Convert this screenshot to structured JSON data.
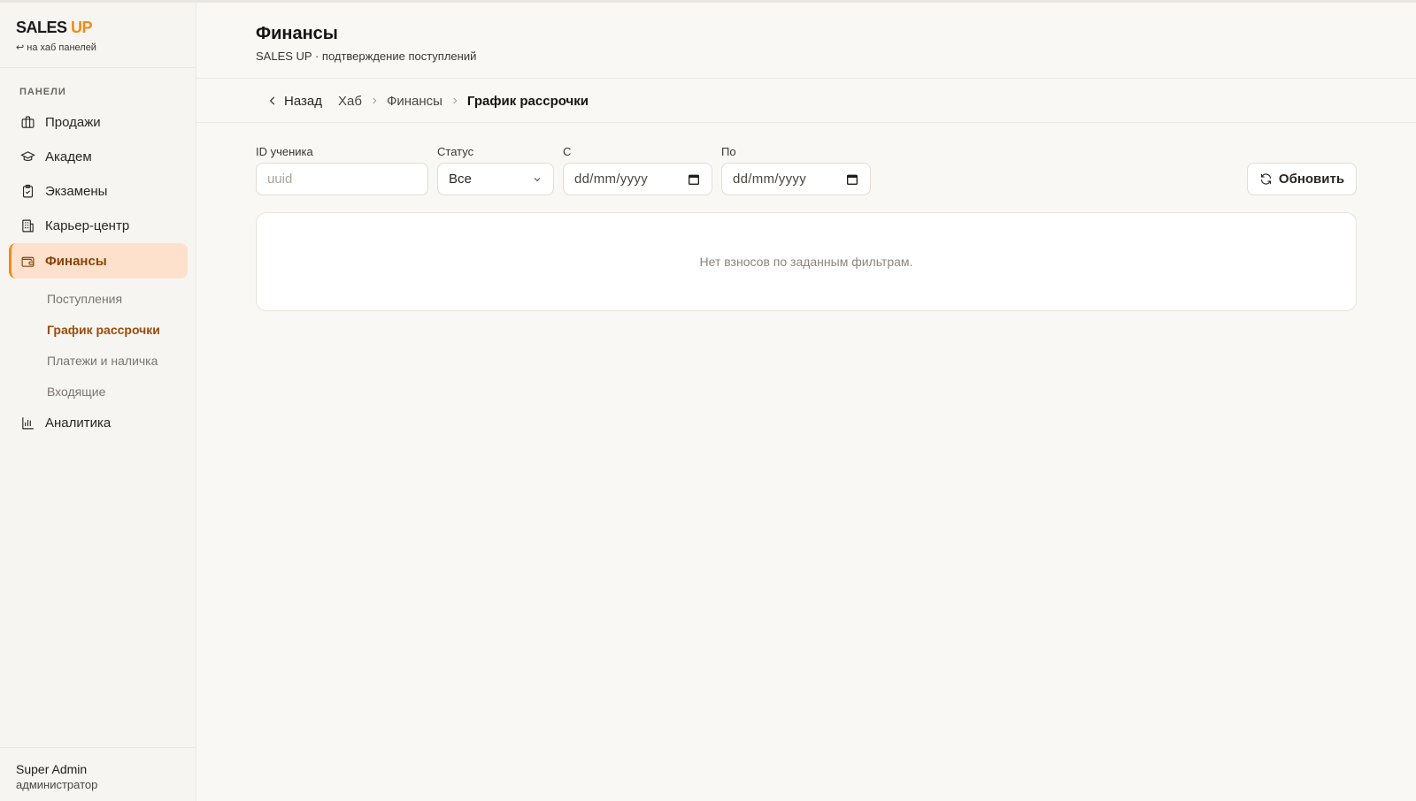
{
  "brand": {
    "name_main": "SALES",
    "name_accent": "UP",
    "hub_link": "↩ на хаб панелей"
  },
  "sidebar": {
    "section_label": "ПАНЕЛИ",
    "items": [
      {
        "label": "Продажи",
        "icon": "briefcase-icon"
      },
      {
        "label": "Академ",
        "icon": "graduation-cap-icon"
      },
      {
        "label": "Экзамены",
        "icon": "clipboard-check-icon"
      },
      {
        "label": "Карьер-центр",
        "icon": "building-icon"
      },
      {
        "label": "Финансы",
        "icon": "wallet-icon",
        "active": true
      },
      {
        "label": "Аналитика",
        "icon": "bar-chart-icon"
      }
    ],
    "sub_items": [
      {
        "label": "Поступления"
      },
      {
        "label": "График рассрочки",
        "active": true
      },
      {
        "label": "Платежи и наличка"
      },
      {
        "label": "Входящие"
      }
    ]
  },
  "user": {
    "name": "Super Admin",
    "role": "администратор"
  },
  "header": {
    "title": "Финансы",
    "subtitle": "SALES UP · подтверждение поступлений"
  },
  "breadcrumb": {
    "back": "Назад",
    "items": [
      "Хаб",
      "Финансы"
    ],
    "current": "График рассрочки"
  },
  "filters": {
    "student_id": {
      "label": "ID ученика",
      "placeholder": "uuid",
      "value": ""
    },
    "status": {
      "label": "Статус",
      "value": "Все"
    },
    "from": {
      "label": "С",
      "placeholder": "dd/mm/yyyy"
    },
    "to": {
      "label": "По",
      "placeholder": "dd/mm/yyyy"
    },
    "refresh_label": "Обновить"
  },
  "empty_state": {
    "text": "Нет взносов по заданным фильтрам."
  },
  "colors": {
    "accent": "#f08a1a",
    "active_bg": "#fde1cc",
    "active_text": "#8a4308"
  }
}
